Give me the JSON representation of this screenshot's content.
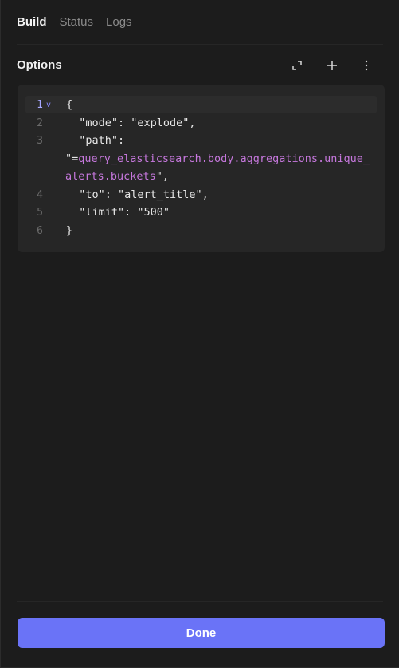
{
  "tabs": [
    {
      "label": "Build",
      "active": true
    },
    {
      "label": "Status",
      "active": false
    },
    {
      "label": "Logs",
      "active": false
    }
  ],
  "options": {
    "title": "Options",
    "icons": [
      "expand-icon",
      "plus-icon",
      "more-vertical-icon"
    ]
  },
  "editor": {
    "lines": [
      {
        "num": "1",
        "text": "{"
      },
      {
        "num": "2",
        "text": "  \"mode\": \"explode\","
      },
      {
        "num": "3",
        "text": "  \"path\":"
      },
      {
        "num": "",
        "prefix": "\"=",
        "text": "query_elasticsearch.body.aggregations.unique_"
      },
      {
        "num": "",
        "text": "alerts.buckets",
        "suffix": "\","
      },
      {
        "num": "4",
        "text": "  \"to\": \"alert_title\","
      },
      {
        "num": "5",
        "text": "  \"limit\": \"500\""
      },
      {
        "num": "6",
        "text": "}"
      }
    ],
    "fold_marker": "v"
  },
  "footer": {
    "done_label": "Done"
  },
  "colors": {
    "accent": "#6a73f7",
    "background": "#1c1c1c",
    "editor_bg": "#262626",
    "expression": "#c678dd"
  }
}
